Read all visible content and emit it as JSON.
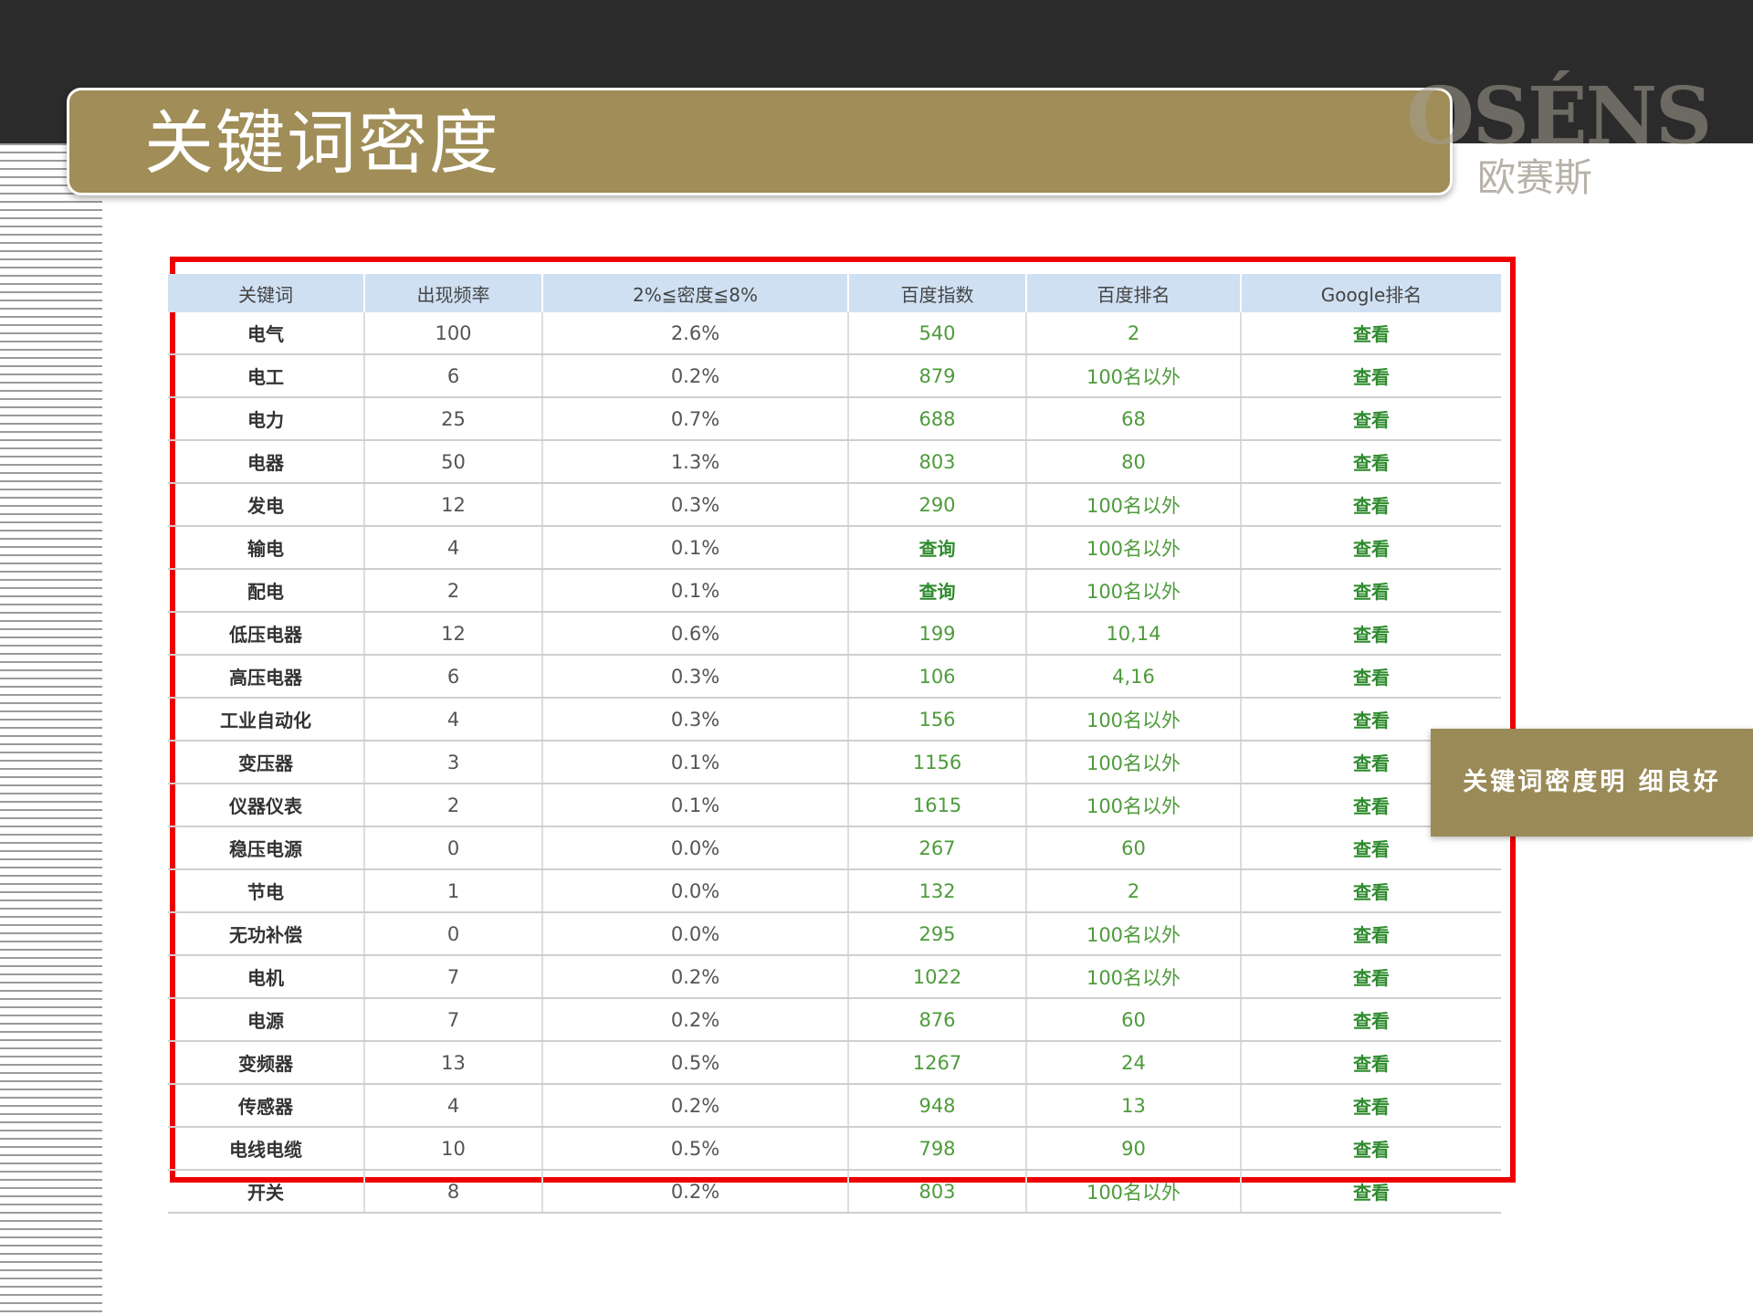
{
  "slide": {
    "title": "关键词密度",
    "logo_text": "OSÉNS",
    "logo_cn": "欧赛斯",
    "callout": "关键词密度明 细良好",
    "colors": {
      "title_bar": "#a08d57",
      "frame": "#ee0000",
      "header_bg": "#cfe0f3",
      "green": "#4d9b3a"
    }
  },
  "table": {
    "headers": [
      "关键词",
      "出现频率",
      "2%≦密度≦8%",
      "百度指数",
      "百度排名",
      "Google排名"
    ],
    "rows": [
      [
        "电气",
        "100",
        "2.6%",
        "540",
        "2",
        "查看"
      ],
      [
        "电工",
        "6",
        "0.2%",
        "879",
        "100名以外",
        "查看"
      ],
      [
        "电力",
        "25",
        "0.7%",
        "688",
        "68",
        "查看"
      ],
      [
        "电器",
        "50",
        "1.3%",
        "803",
        "80",
        "查看"
      ],
      [
        "发电",
        "12",
        "0.3%",
        "290",
        "100名以外",
        "查看"
      ],
      [
        "输电",
        "4",
        "0.1%",
        "查询",
        "100名以外",
        "查看"
      ],
      [
        "配电",
        "2",
        "0.1%",
        "查询",
        "100名以外",
        "查看"
      ],
      [
        "低压电器",
        "12",
        "0.6%",
        "199",
        "10,14",
        "查看"
      ],
      [
        "高压电器",
        "6",
        "0.3%",
        "106",
        "4,16",
        "查看"
      ],
      [
        "工业自动化",
        "4",
        "0.3%",
        "156",
        "100名以外",
        "查看"
      ],
      [
        "变压器",
        "3",
        "0.1%",
        "1156",
        "100名以外",
        "查看"
      ],
      [
        "仪器仪表",
        "2",
        "0.1%",
        "1615",
        "100名以外",
        "查看"
      ],
      [
        "稳压电源",
        "0",
        "0.0%",
        "267",
        "60",
        "查看"
      ],
      [
        "节电",
        "1",
        "0.0%",
        "132",
        "2",
        "查看"
      ],
      [
        "无功补偿",
        "0",
        "0.0%",
        "295",
        "100名以外",
        "查看"
      ],
      [
        "电机",
        "7",
        "0.2%",
        "1022",
        "100名以外",
        "查看"
      ],
      [
        "电源",
        "7",
        "0.2%",
        "876",
        "60",
        "查看"
      ],
      [
        "变频器",
        "13",
        "0.5%",
        "1267",
        "24",
        "查看"
      ],
      [
        "传感器",
        "4",
        "0.2%",
        "948",
        "13",
        "查看"
      ],
      [
        "电线电缆",
        "10",
        "0.5%",
        "798",
        "90",
        "查看"
      ],
      [
        "开关",
        "8",
        "0.2%",
        "803",
        "100名以外",
        "查看"
      ]
    ]
  }
}
